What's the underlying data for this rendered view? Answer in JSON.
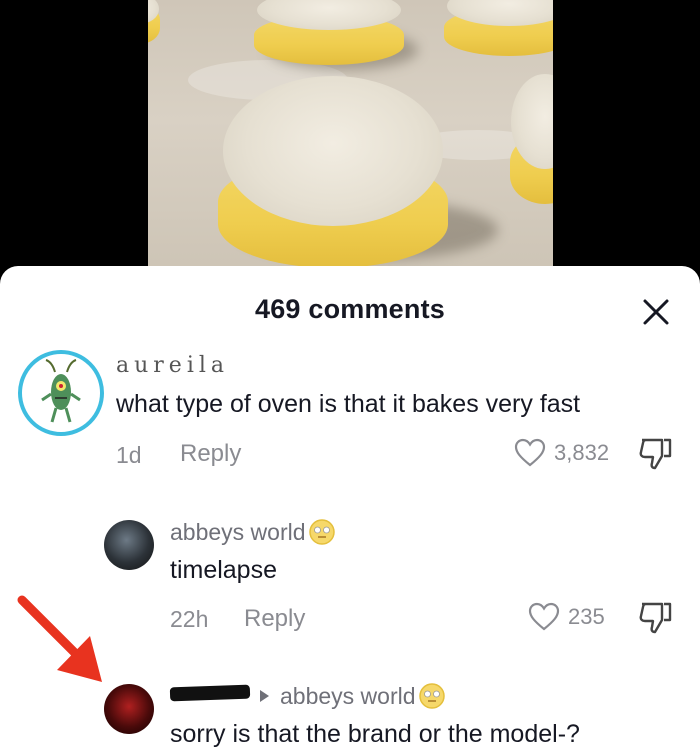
{
  "comments_panel": {
    "title": "469 comments",
    "close_icon": "close-icon"
  },
  "comments": [
    {
      "username": "aureila",
      "text": "what type of oven is that it bakes very fast",
      "age": "1d",
      "reply_label": "Reply",
      "likes": "3,832"
    },
    {
      "username": "abbeys world",
      "text": "timelapse",
      "age": "22h",
      "reply_label": "Reply",
      "likes": "235"
    },
    {
      "reply_to": "abbeys world",
      "text": "sorry is that the brand or the model-?"
    }
  ],
  "colors": {
    "annotation_arrow": "#e8331f",
    "accent_ring": "#3ebde0"
  }
}
